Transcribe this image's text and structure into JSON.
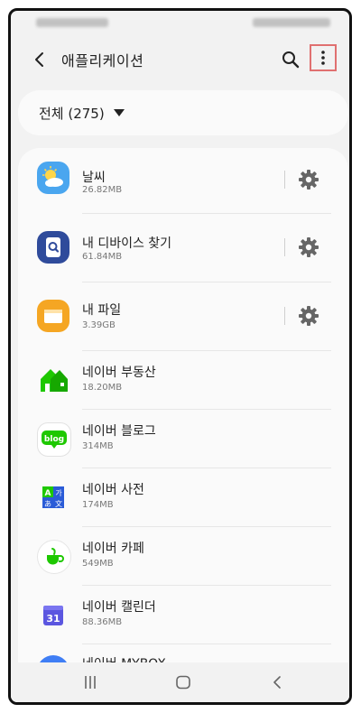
{
  "header": {
    "title": "애플리케이션",
    "back_icon": "back-arrow-icon",
    "search_icon": "search-icon",
    "more_icon": "more-vertical-icon",
    "highlight_color": "#e07070"
  },
  "filter": {
    "label": "전체 (275)",
    "icon": "dropdown-triangle-icon"
  },
  "apps": [
    {
      "name": "날씨",
      "size": "26.82MB",
      "icon": "weather-icon",
      "settings": true
    },
    {
      "name": "내 디바이스 찾기",
      "size": "61.84MB",
      "icon": "find-my-device-icon",
      "settings": true
    },
    {
      "name": "내 파일",
      "size": "3.39GB",
      "icon": "my-files-icon",
      "settings": true
    },
    {
      "name": "네이버 부동산",
      "size": "18.20MB",
      "icon": "naver-real-estate-icon",
      "settings": false
    },
    {
      "name": "네이버 블로그",
      "size": "314MB",
      "icon": "naver-blog-icon",
      "blog_text": "blog",
      "settings": false
    },
    {
      "name": "네이버 사전",
      "size": "174MB",
      "icon": "naver-dictionary-icon",
      "dict_glyphs": [
        "A",
        "가",
        "あ",
        "文"
      ],
      "settings": false
    },
    {
      "name": "네이버 카페",
      "size": "549MB",
      "icon": "naver-cafe-icon",
      "settings": false
    },
    {
      "name": "네이버 캘린더",
      "size": "88.36MB",
      "icon": "naver-calendar-icon",
      "calendar_day": "31",
      "settings": false
    },
    {
      "name": "네이버 MYBOX",
      "size": "",
      "icon": "naver-mybox-icon",
      "settings": false
    }
  ],
  "navbar": {
    "recents_icon": "recents-icon",
    "home_icon": "home-icon",
    "back_icon": "back-icon"
  }
}
